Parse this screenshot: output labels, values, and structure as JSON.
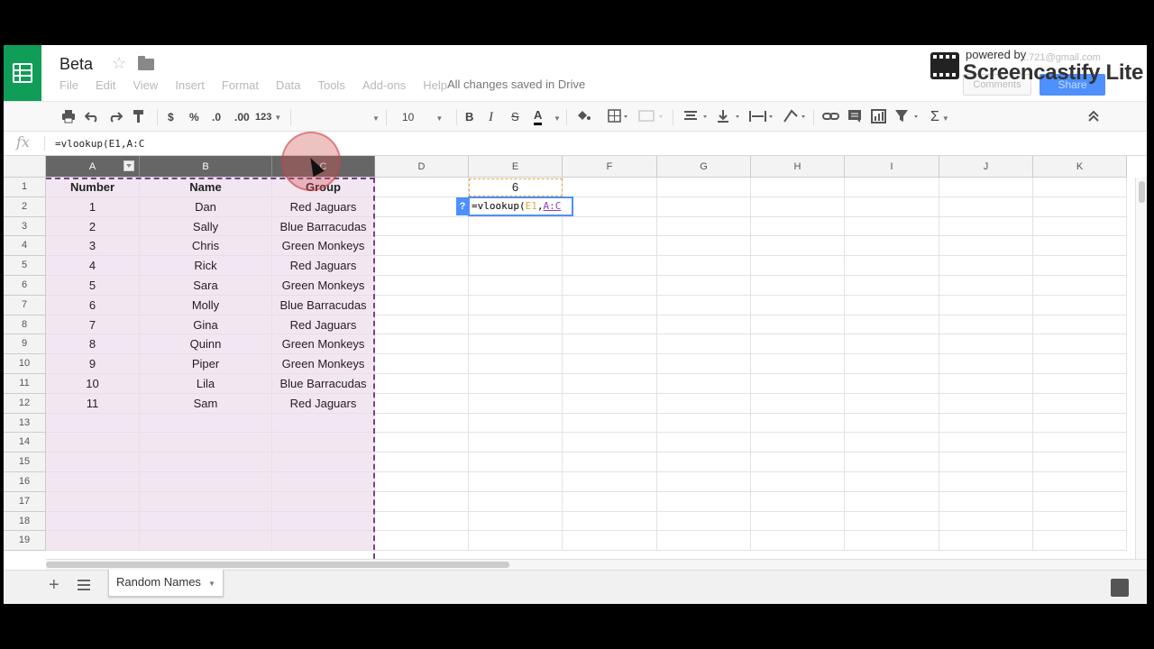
{
  "header": {
    "doc_title": "Beta",
    "menu": [
      "File",
      "Edit",
      "View",
      "Insert",
      "Format",
      "Data",
      "Tools",
      "Add-ons",
      "Help"
    ],
    "save_status": "All changes saved in Drive",
    "comments_label": "Comments",
    "share_label": "Share",
    "account_email": "...721@gmail.com"
  },
  "watermark": {
    "line1": "powered by",
    "line2": "Screencastify Lite"
  },
  "toolbar": {
    "currency": "$",
    "percent": "%",
    "dec_decrease": ".0",
    "dec_increase": ".00",
    "more_formats": "123",
    "font_size": "10",
    "bold": "B",
    "italic": "I",
    "strike": "S",
    "text_color": "A",
    "functions": "Σ"
  },
  "formula_bar": {
    "fx": "fx",
    "text": "=vlookup(E1,A:C"
  },
  "editor": {
    "help": "?",
    "prefix": "=vlookup(",
    "ref1": "E1",
    "sep": ",",
    "ref2": "A:C"
  },
  "columns": [
    "A",
    "B",
    "C",
    "D",
    "E",
    "F",
    "G",
    "H",
    "I",
    "J",
    "K"
  ],
  "rows": [
    "1",
    "2",
    "3",
    "4",
    "5",
    "6",
    "7",
    "8",
    "9",
    "10",
    "11",
    "12",
    "13",
    "14",
    "15",
    "16",
    "17",
    "18",
    "19"
  ],
  "table": {
    "headers": [
      "Number",
      "Name",
      "Group"
    ],
    "data": [
      [
        "1",
        "Dan",
        "Red Jaguars"
      ],
      [
        "2",
        "Sally",
        "Blue Barracudas"
      ],
      [
        "3",
        "Chris",
        "Green Monkeys"
      ],
      [
        "4",
        "Rick",
        "Red Jaguars"
      ],
      [
        "5",
        "Sara",
        "Green Monkeys"
      ],
      [
        "6",
        "Molly",
        "Blue Barracudas"
      ],
      [
        "7",
        "Gina",
        "Red Jaguars"
      ],
      [
        "8",
        "Quinn",
        "Green Monkeys"
      ],
      [
        "9",
        "Piper",
        "Green Monkeys"
      ],
      [
        "10",
        "Lila",
        "Blue Barracudas"
      ],
      [
        "11",
        "Sam",
        "Red Jaguars"
      ]
    ]
  },
  "e1_value": "6",
  "sheet_tab": "Random Names",
  "colors": {
    "sheets_green": "#0f9d58",
    "selection_fill": "#f3e6f3",
    "range_border": "#7a3e8c",
    "accent_blue": "#4d90fe"
  }
}
